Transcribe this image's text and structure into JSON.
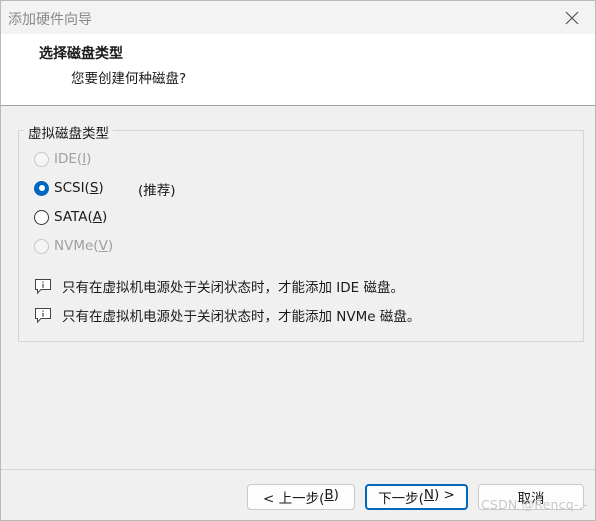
{
  "window": {
    "title": "添加硬件向导"
  },
  "header": {
    "title": "选择磁盘类型",
    "subtitle": "您要创建何种磁盘?"
  },
  "group": {
    "label": "虚拟磁盘类型",
    "options": [
      {
        "prefix": "IDE(",
        "key": "I",
        "suffix": ")",
        "enabled": false,
        "selected": false
      },
      {
        "prefix": "SCSI(",
        "key": "S",
        "suffix": ")",
        "enabled": true,
        "selected": true
      },
      {
        "prefix": "SATA(",
        "key": "A",
        "suffix": ")",
        "enabled": true,
        "selected": false
      },
      {
        "prefix": "NVMe(",
        "key": "V",
        "suffix": ")",
        "enabled": false,
        "selected": false
      }
    ],
    "recommended_label": "(推荐)",
    "notes": [
      "只有在虚拟机电源处于关闭状态时，才能添加 IDE 磁盘。",
      "只有在虚拟机电源处于关闭状态时，才能添加 NVMe 磁盘。"
    ]
  },
  "buttons": {
    "back": {
      "prefix": "< 上一步(",
      "key": "B",
      "suffix": ")"
    },
    "next": {
      "prefix": "下一步(",
      "key": "N",
      "suffix": ") >"
    },
    "cancel": {
      "label": "取消"
    }
  },
  "watermark": "CSDN @Rencq-.-",
  "colors": {
    "accent": "#0067c0",
    "disabled_text": "#a0a0a0"
  }
}
